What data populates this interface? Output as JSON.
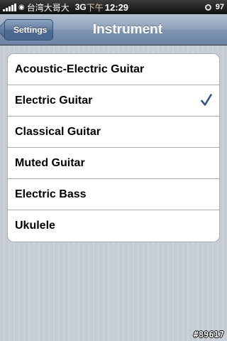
{
  "status_bar": {
    "carrier": "台湾大哥大",
    "network": "3G",
    "time_ampm": "下午",
    "time": "12:29",
    "battery": "97",
    "icons": [
      "signal-icon",
      "wifi-icon",
      "alarm-icon"
    ]
  },
  "nav": {
    "back_label": "Settings",
    "title": "Instrument"
  },
  "instruments": {
    "items": [
      {
        "label": "Acoustic-Electric Guitar",
        "selected": false
      },
      {
        "label": "Electric Guitar",
        "selected": true
      },
      {
        "label": "Classical Guitar",
        "selected": false
      },
      {
        "label": "Muted Guitar",
        "selected": false
      },
      {
        "label": "Electric Bass",
        "selected": false
      },
      {
        "label": "Ukulele",
        "selected": false
      }
    ],
    "check_color": "#385487"
  },
  "watermark": "#89617"
}
